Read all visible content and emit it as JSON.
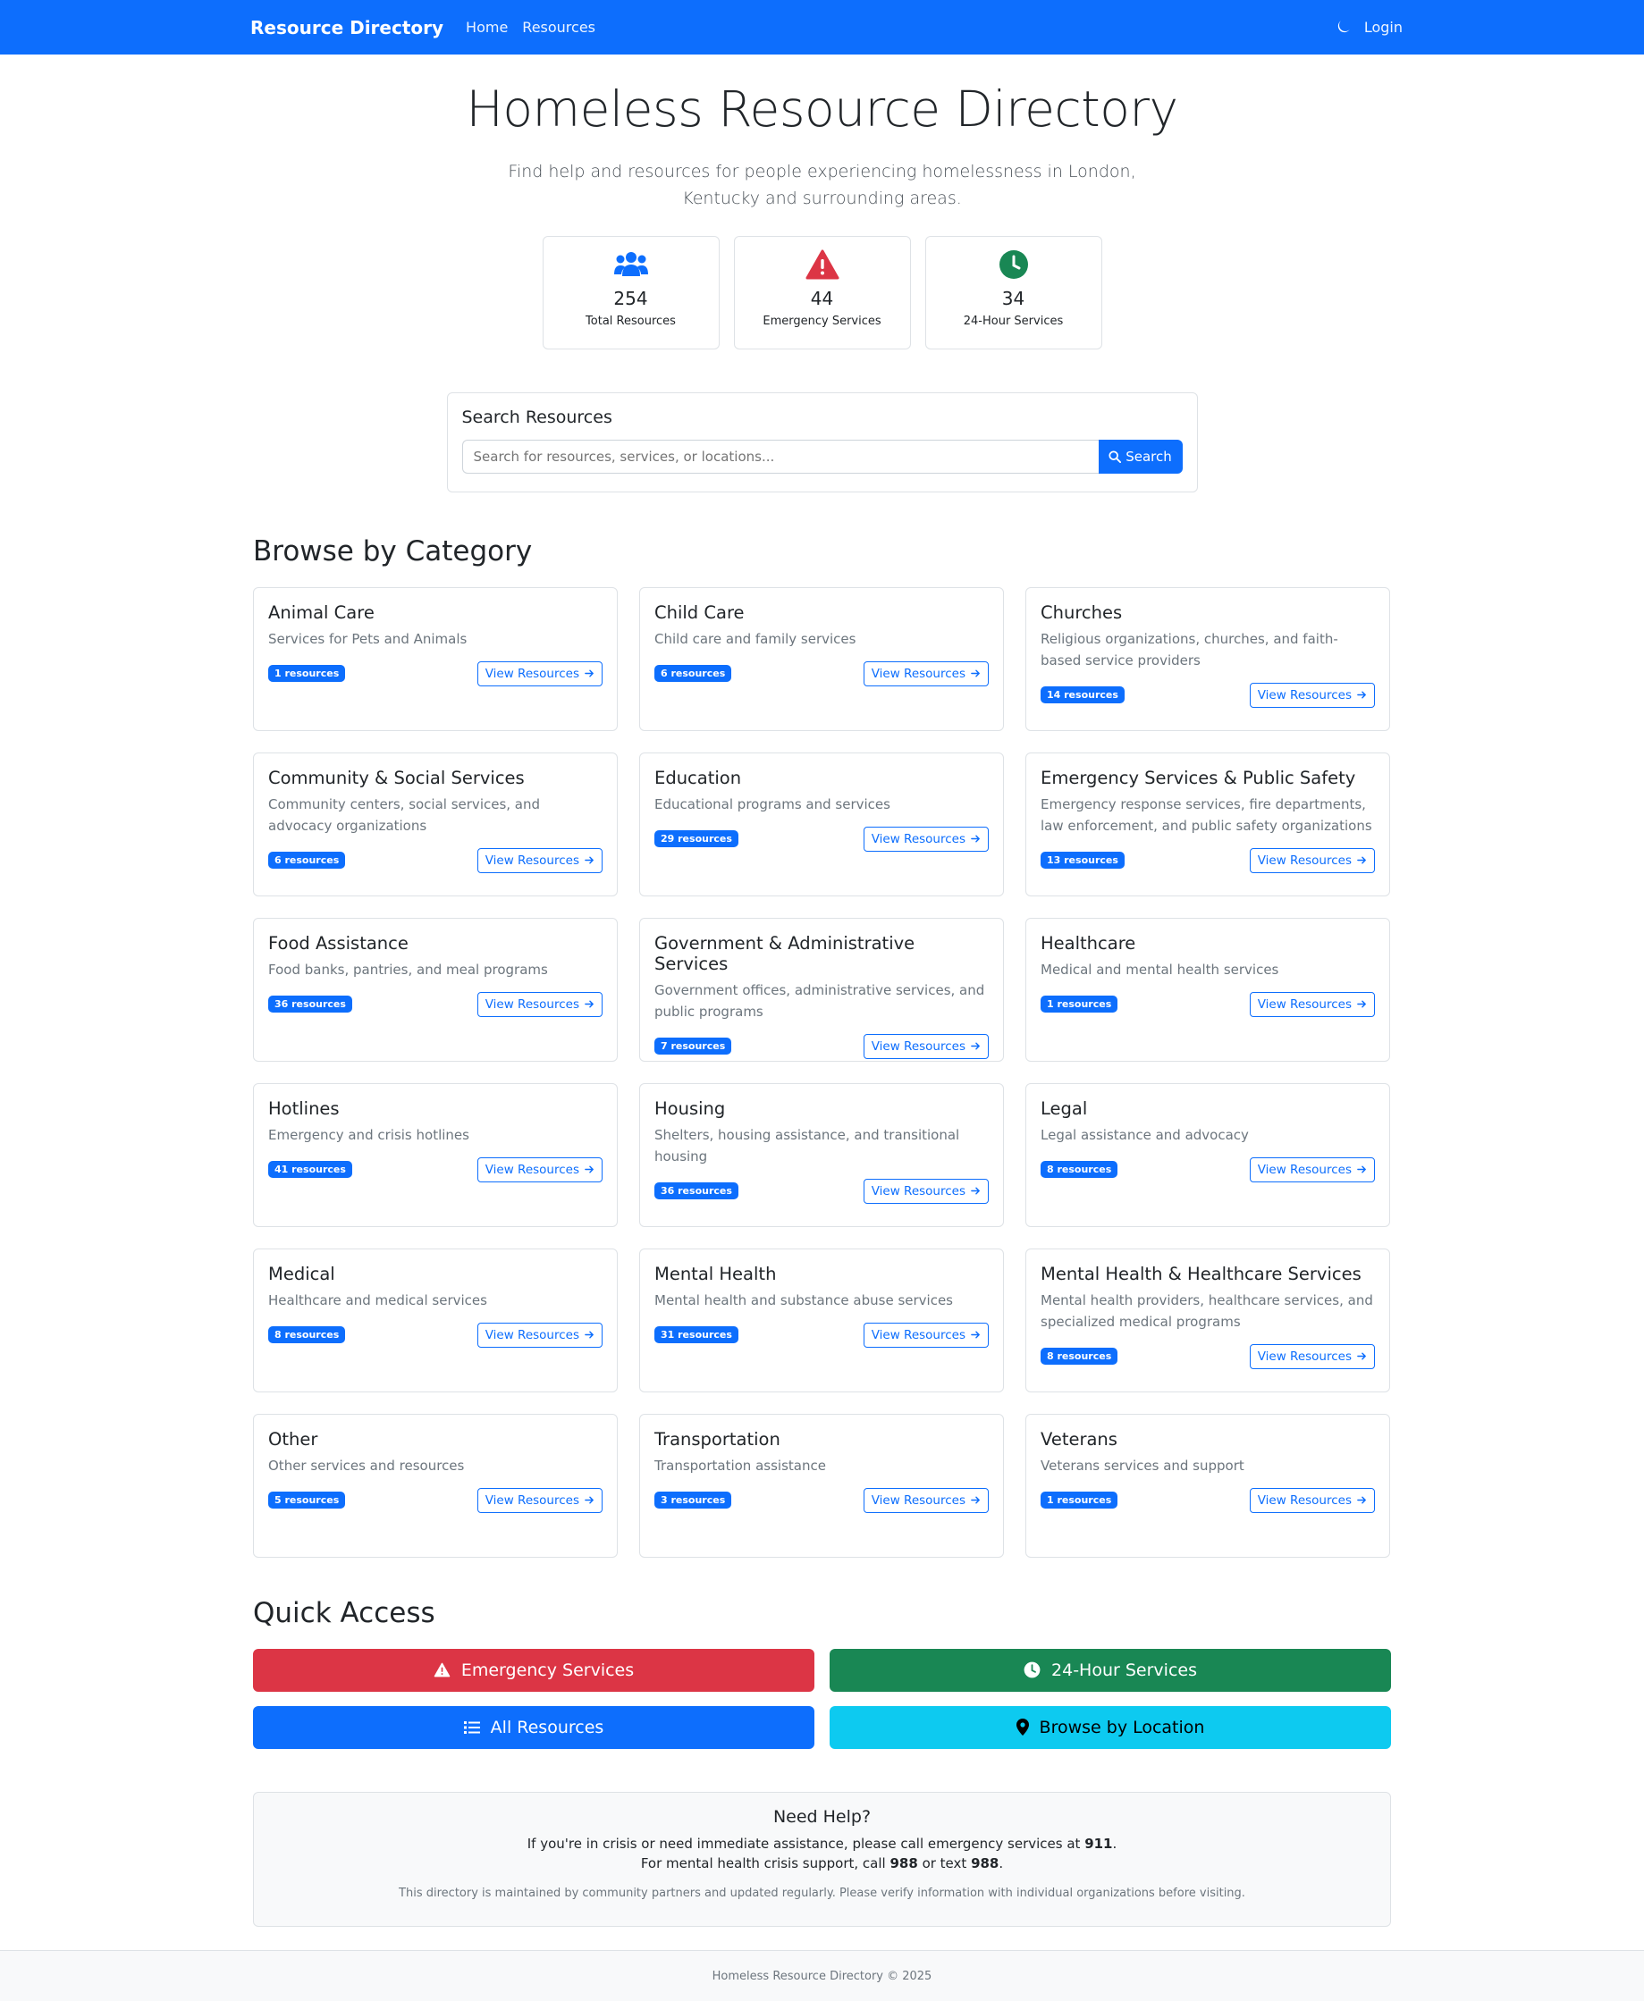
{
  "navbar": {
    "brand": "Resource Directory",
    "links": [
      "Home",
      "Resources"
    ],
    "login": "Login",
    "theme_icon": "moon-icon"
  },
  "hero": {
    "title": "Homeless Resource Directory",
    "subtitle": "Find help and resources for people experiencing homelessness in London, Kentucky and surrounding areas."
  },
  "stats": [
    {
      "icon": "people-icon",
      "value": "254",
      "label": "Total Resources",
      "color": "#0d6efd"
    },
    {
      "icon": "warning-icon",
      "value": "44",
      "label": "Emergency Services",
      "color": "#dc3545"
    },
    {
      "icon": "clock-icon",
      "value": "34",
      "label": "24-Hour Services",
      "color": "#198754"
    }
  ],
  "search": {
    "title": "Search Resources",
    "placeholder": "Search for resources, services, or locations...",
    "button": "Search"
  },
  "categories_heading": "Browse by Category",
  "view_label": "View Resources",
  "categories": [
    {
      "title": "Animal Care",
      "desc": "Services for Pets and Animals",
      "count": "1 resources"
    },
    {
      "title": "Child Care",
      "desc": "Child care and family services",
      "count": "6 resources"
    },
    {
      "title": "Churches",
      "desc": "Religious organizations, churches, and faith-based service providers",
      "count": "14 resources"
    },
    {
      "title": "Community & Social Services",
      "desc": "Community centers, social services, and advocacy organizations",
      "count": "6 resources"
    },
    {
      "title": "Education",
      "desc": "Educational programs and services",
      "count": "29 resources"
    },
    {
      "title": "Emergency Services & Public Safety",
      "desc": "Emergency response services, fire departments, law enforcement, and public safety organizations",
      "count": "13 resources"
    },
    {
      "title": "Food Assistance",
      "desc": "Food banks, pantries, and meal programs",
      "count": "36 resources"
    },
    {
      "title": "Government & Administrative Services",
      "desc": "Government offices, administrative services, and public programs",
      "count": "7 resources"
    },
    {
      "title": "Healthcare",
      "desc": "Medical and mental health services",
      "count": "1 resources"
    },
    {
      "title": "Hotlines",
      "desc": "Emergency and crisis hotlines",
      "count": "41 resources"
    },
    {
      "title": "Housing",
      "desc": "Shelters, housing assistance, and transitional housing",
      "count": "36 resources"
    },
    {
      "title": "Legal",
      "desc": "Legal assistance and advocacy",
      "count": "8 resources"
    },
    {
      "title": "Medical",
      "desc": "Healthcare and medical services",
      "count": "8 resources"
    },
    {
      "title": "Mental Health",
      "desc": "Mental health and substance abuse services",
      "count": "31 resources"
    },
    {
      "title": "Mental Health & Healthcare Services",
      "desc": "Mental health providers, healthcare services, and specialized medical programs",
      "count": "8 resources"
    },
    {
      "title": "Other",
      "desc": "Other services and resources",
      "count": "5 resources"
    },
    {
      "title": "Transportation",
      "desc": "Transportation assistance",
      "count": "3 resources"
    },
    {
      "title": "Veterans",
      "desc": "Veterans services and support",
      "count": "1 resources"
    }
  ],
  "quick_access": {
    "heading": "Quick Access",
    "buttons": [
      {
        "label": "Emergency Services",
        "icon": "warning-icon",
        "color": "#dc3545"
      },
      {
        "label": "24-Hour Services",
        "icon": "clock-icon",
        "color": "#198754"
      },
      {
        "label": "All Resources",
        "icon": "list-icon",
        "color": "#0d6efd"
      },
      {
        "label": "Browse by Location",
        "icon": "map-pin-icon",
        "color": "#0dcaf0"
      }
    ]
  },
  "help": {
    "title": "Need Help?",
    "line1_pre": "If you're in crisis or need immediate assistance, please call emergency services at ",
    "line1_num": "911",
    "line1_post": ".",
    "line2_pre": "For mental health crisis support, call ",
    "line2_num1": "988",
    "line2_mid": " or text ",
    "line2_num2": "988",
    "line2_post": ".",
    "note": "This directory is maintained by community partners and updated regularly. Please verify information with individual organizations before visiting."
  },
  "footer": {
    "text": "Homeless Resource Directory © 2025"
  }
}
